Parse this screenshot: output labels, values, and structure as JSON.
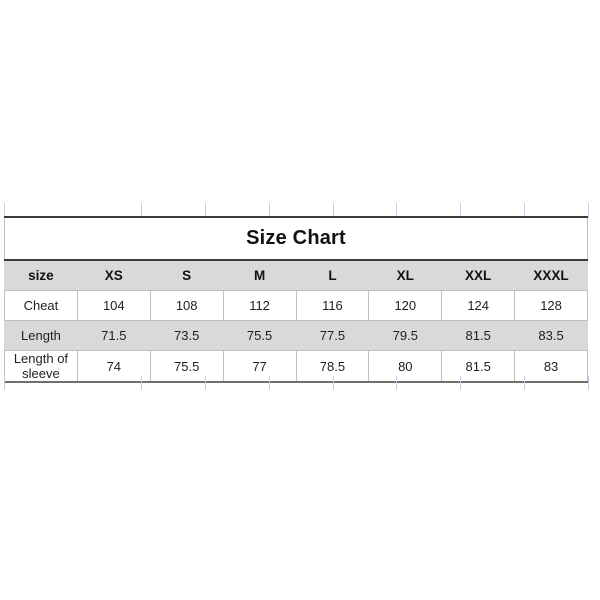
{
  "page": {
    "background_color": "#ffffff",
    "header_fill_color": "#d9d9d9",
    "row_shade_color": "#d9d9d9",
    "border_color": "#bfbfbf",
    "title_rule_color": "#3a3a3a",
    "gridline_color": "#c8ccdd"
  },
  "table": {
    "title": "Size Chart",
    "row_header_label": "size",
    "size_columns": [
      "XS",
      "S",
      "M",
      "L",
      "XL",
      "XXL",
      "XXXL"
    ],
    "rows": [
      {
        "label": "Cheat",
        "shaded": false,
        "values": [
          "104",
          "108",
          "112",
          "116",
          "120",
          "124",
          "128"
        ]
      },
      {
        "label": "Length",
        "shaded": true,
        "values": [
          "71.5",
          "73.5",
          "75.5",
          "77.5",
          "79.5",
          "81.5",
          "83.5"
        ]
      },
      {
        "label": "Length of sleeve",
        "shaded": false,
        "values": [
          "74",
          "75.5",
          "77",
          "78.5",
          "80",
          "81.5",
          "83"
        ]
      }
    ]
  },
  "chart_data": {
    "type": "table",
    "title": "Size Chart",
    "categories": [
      "XS",
      "S",
      "M",
      "L",
      "XL",
      "XXL",
      "XXXL"
    ],
    "xlabel": "size",
    "ylabel": "",
    "series": [
      {
        "name": "Cheat",
        "values": [
          104,
          108,
          112,
          116,
          120,
          124,
          128
        ]
      },
      {
        "name": "Length",
        "values": [
          71.5,
          73.5,
          75.5,
          77.5,
          79.5,
          81.5,
          83.5
        ]
      },
      {
        "name": "Length of sleeve",
        "values": [
          74,
          75.5,
          77,
          78.5,
          80,
          81.5,
          83
        ]
      }
    ],
    "units": "cm",
    "grid": true,
    "legend": "none"
  }
}
